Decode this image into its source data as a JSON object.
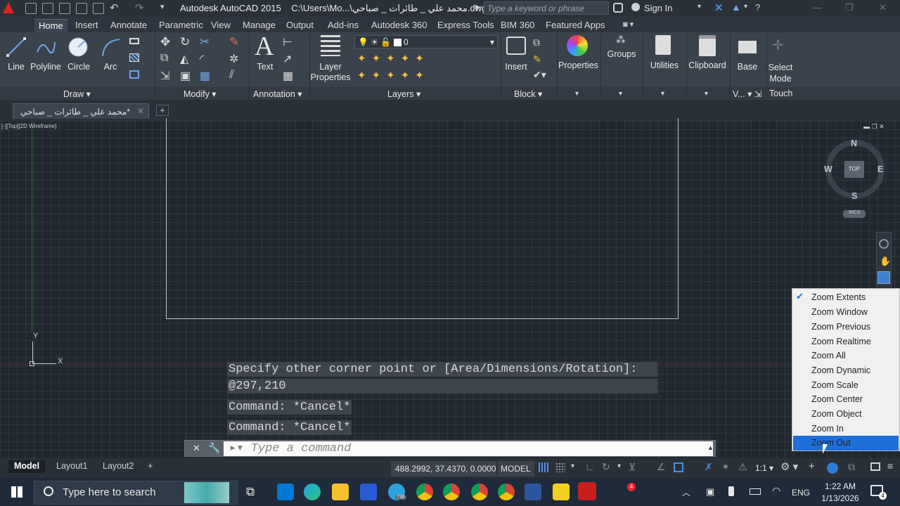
{
  "app": {
    "title": "Autodesk AutoCAD 2015",
    "file_path": "C:\\Users\\Mo...\\محمد علي _ طائرات _ صباحي.dwg",
    "search_placeholder": "Type a keyword or phrase",
    "sign_in": "Sign In"
  },
  "ribbon_tabs": [
    "Home",
    "Insert",
    "Annotate",
    "Parametric",
    "View",
    "Manage",
    "Output",
    "Add-ins",
    "Autodesk 360",
    "Express Tools",
    "BIM 360",
    "Featured Apps"
  ],
  "draw_tools": [
    "Line",
    "Polyline",
    "Circle",
    "Arc"
  ],
  "text_tool": "Text",
  "layer_props": "Layer Properties",
  "layer_value": "0",
  "insert": "Insert",
  "properties": "Properties",
  "groups": "Groups",
  "utilities": "Utilities",
  "clipboard": "Clipboard",
  "base": "Base",
  "select_mode": "Select Mode",
  "panels": {
    "draw": "Draw",
    "modify": "Modify",
    "annotation": "Annotation",
    "layers": "Layers",
    "block": "Block",
    "view": "V...",
    "touch": "Touch"
  },
  "doc_tab": "محمد علي _ طائرات _ صباحي*",
  "viewport_label": "[-][Top][2D Wireframe]",
  "viewcube": {
    "n": "N",
    "s": "S",
    "e": "E",
    "w": "W",
    "top": "TOP",
    "wcs": "WCS"
  },
  "ucs": {
    "x": "X",
    "y": "Y"
  },
  "command_history": [
    "Specify other corner point or [Area/Dimensions/Rotation]:",
    "@297,210",
    "Command: *Cancel*",
    "Command: *Cancel*"
  ],
  "command_placeholder": "Type a command",
  "zoom_menu": [
    "Zoom Extents",
    "Zoom Window",
    "Zoom Previous",
    "Zoom Realtime",
    "Zoom All",
    "Zoom Dynamic",
    "Zoom Scale",
    "Zoom Center",
    "Zoom Object",
    "Zoom In",
    "Zoom Out"
  ],
  "zoom_checked": "Zoom Extents",
  "zoom_highlighted": "Zoom Out",
  "layout_tabs": [
    "Model",
    "Layout1",
    "Layout2"
  ],
  "coords": "488.2992, 37.4370, 0.0000",
  "model_btn": "MODEL",
  "scale": "1:1",
  "taskbar": {
    "search": "Type here to search",
    "lang": "ENG",
    "time": "1:22 AM",
    "date": "1/13/2026",
    "badge_acad": "4",
    "badge_tg": "736",
    "notif_count": "4"
  }
}
